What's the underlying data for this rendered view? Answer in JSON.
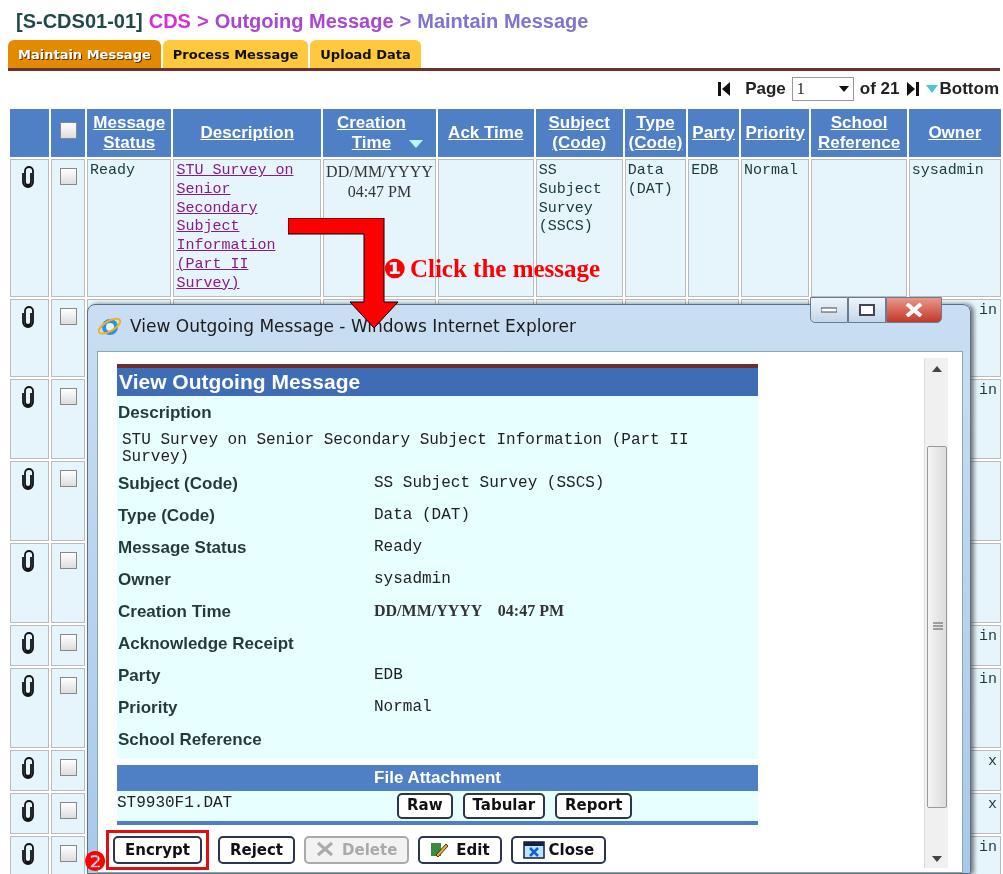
{
  "breadcrumb": {
    "code": "[S-CDS01-01]",
    "items": [
      {
        "text": "CDS",
        "color": "#d431d4"
      },
      {
        "text": ">",
        "color": "#c03ad0"
      },
      {
        "text": "Outgoing Message",
        "color": "#a847cf"
      },
      {
        "text": ">",
        "color": "#8f5fd0"
      },
      {
        "text": "Maintain Message",
        "color": "#7f75d0"
      }
    ]
  },
  "tabs": [
    {
      "label": "Maintain Message",
      "selected": true
    },
    {
      "label": "Process Message",
      "selected": false
    },
    {
      "label": "Upload Data",
      "selected": false
    }
  ],
  "pager": {
    "page_label": "Page",
    "page": "1",
    "of": "of 21",
    "bottom": "Bottom"
  },
  "table": {
    "select_all_checked": false,
    "columns": [
      {
        "label": "Message Status",
        "sorted": false
      },
      {
        "label": "Description",
        "sorted": false
      },
      {
        "label": "Creation Time",
        "sorted": true
      },
      {
        "label": "Ack Time",
        "sorted": false
      },
      {
        "label": "Subject (Code)",
        "sorted": false
      },
      {
        "label": "Type (Code)",
        "sorted": false
      },
      {
        "label": "Party",
        "sorted": false
      },
      {
        "label": "Priority",
        "sorted": false
      },
      {
        "label": "School Reference",
        "sorted": false
      },
      {
        "label": "Owner",
        "sorted": false
      }
    ],
    "rows": [
      {
        "checked": false,
        "status": "Ready",
        "description": "STU Survey on Senior Secondary Subject Information (Part II Survey)",
        "creation_date": "DD/MM/YYYY",
        "creation_time": "04:47 PM",
        "subject": "SS Subject Survey (SSCS)",
        "type": "Data (DAT)",
        "party": "EDB",
        "priority": "Normal",
        "owner": "sysadmin"
      },
      {
        "checked": false,
        "owner": "in"
      },
      {
        "checked": false,
        "owner": "in"
      },
      {
        "checked": false
      },
      {
        "checked": false
      },
      {
        "checked": false,
        "owner": "in"
      },
      {
        "checked": false,
        "owner": "in"
      },
      {
        "checked": false,
        "owner": "x"
      },
      {
        "checked": false,
        "owner": "x"
      },
      {
        "checked": false,
        "owner": "in"
      }
    ]
  },
  "callouts": [
    {
      "number": "❶",
      "text": "Click the message"
    },
    {
      "number": "❷"
    }
  ],
  "popup": {
    "title": "View Outgoing Message - Windows Internet Explorer",
    "heading": "View Outgoing Message",
    "description_label": "Description",
    "description": "STU Survey on Senior Secondary Subject Information (Part II Survey)",
    "fields": [
      {
        "label": "Subject (Code)",
        "value": "SS Subject Survey (SSCS)",
        "kind": "text"
      },
      {
        "label": "Type (Code)",
        "value": "Data (DAT)",
        "kind": "text"
      },
      {
        "label": "Message Status",
        "value": "Ready",
        "kind": "text"
      },
      {
        "label": "Owner",
        "value": "sysadmin",
        "kind": "text"
      },
      {
        "label": "Creation Time",
        "value": "DD/MM/YYYY    04:47 PM",
        "kind": "datetime"
      },
      {
        "label": "Acknowledge Receipt",
        "kind": "text"
      },
      {
        "label": "Party",
        "value": "EDB",
        "kind": "text"
      },
      {
        "label": "Priority",
        "value": "Normal",
        "kind": "text"
      },
      {
        "label": "School Reference",
        "kind": "text"
      }
    ],
    "attachment_header": "File Attachment",
    "file": "ST9930F1.DAT",
    "file_buttons": [
      "Raw",
      "Tabular",
      "Report"
    ],
    "actions": [
      {
        "label": "Encrypt",
        "kind": "plain",
        "disabled": false,
        "highlighted": true
      },
      {
        "label": "Reject",
        "kind": "plain",
        "disabled": false,
        "highlighted": false
      },
      {
        "label": "Delete",
        "kind": "delete",
        "disabled": true,
        "highlighted": false
      },
      {
        "label": "Edit",
        "kind": "edit",
        "disabled": false,
        "highlighted": false
      },
      {
        "label": "Close",
        "kind": "close",
        "disabled": false,
        "highlighted": false
      }
    ]
  }
}
